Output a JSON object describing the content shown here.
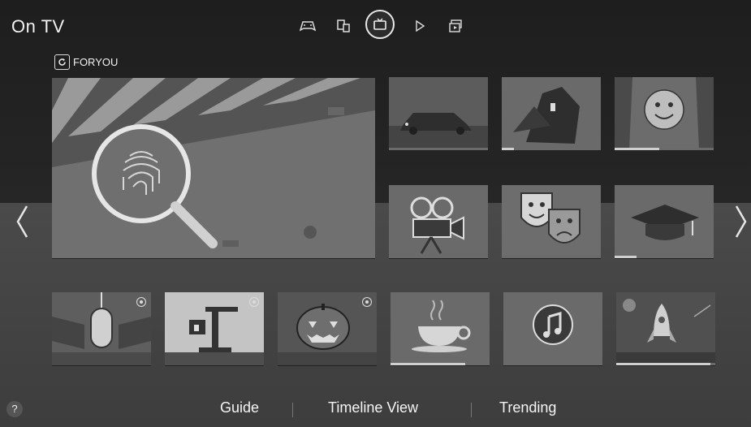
{
  "app": {
    "title": "On TV"
  },
  "topnav": {
    "items": [
      {
        "name": "games",
        "icon": "gamepad-icon"
      },
      {
        "name": "multi-device",
        "icon": "devices-icon"
      },
      {
        "name": "on-tv",
        "icon": "tv-icon",
        "active": true
      },
      {
        "name": "play",
        "icon": "play-icon"
      },
      {
        "name": "apps",
        "icon": "apps-icon"
      }
    ]
  },
  "section": {
    "label": "FORYOU",
    "icon": "refresh-icon"
  },
  "featured": {
    "icon": "fingerprint-magnifier-icon"
  },
  "tiles_grid": [
    {
      "icon": "car-night-icon",
      "progress": 0.0
    },
    {
      "icon": "crime-scene-icon",
      "progress": 0.12
    },
    {
      "icon": "smiley-stage-icon",
      "progress": 0.45
    },
    {
      "icon": "movie-projector-icon",
      "progress": 0.0
    },
    {
      "icon": "drama-masks-icon",
      "progress": 0.0
    },
    {
      "icon": "graduation-cap-icon",
      "progress": 0.22
    }
  ],
  "tiles_row": [
    {
      "icon": "microphone-icon",
      "badge": true,
      "progress": 0.0
    },
    {
      "icon": "lab-stand-icon",
      "badge": true,
      "progress": 0.0
    },
    {
      "icon": "halloween-pumpkin-icon",
      "badge": true,
      "progress": 0.0
    },
    {
      "icon": "coffee-cup-icon",
      "badge": false,
      "progress": 0.75
    },
    {
      "icon": "music-note-icon",
      "badge": false,
      "progress": 0.0
    },
    {
      "icon": "rocket-icon",
      "badge": false,
      "progress": 0.95
    }
  ],
  "bottom": {
    "help": "?",
    "tabs": [
      "Guide",
      "Timeline View",
      "Trending"
    ]
  },
  "colors": {
    "accent": "#e8e8e8",
    "background": "#3a3a3a"
  }
}
